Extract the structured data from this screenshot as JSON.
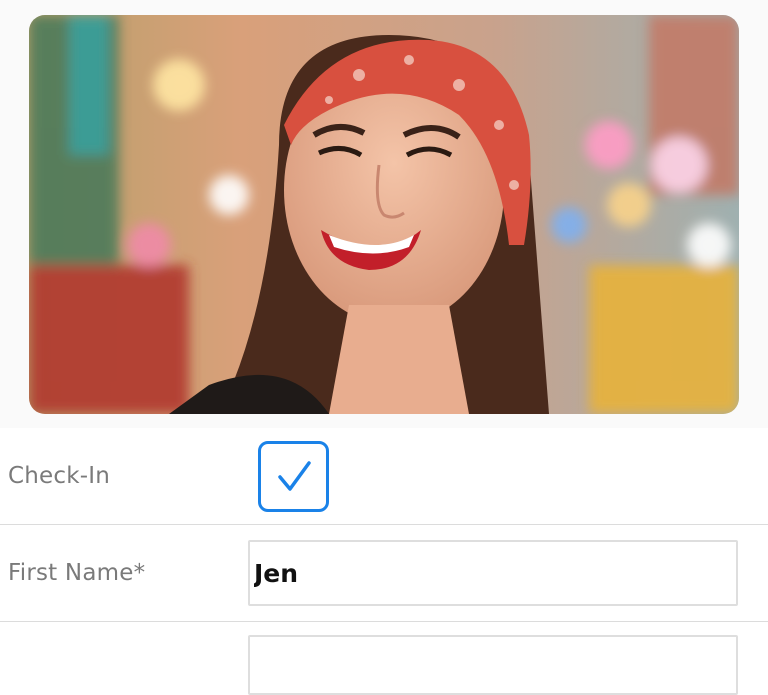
{
  "profile": {
    "photo_alt": "profile-photo",
    "accent_color": "#1a82e8"
  },
  "form": {
    "checkin": {
      "label": "Check-In",
      "checked": true
    },
    "first_name": {
      "label": "First Name*",
      "value": "Jen"
    },
    "next_field": {
      "value": ""
    }
  }
}
